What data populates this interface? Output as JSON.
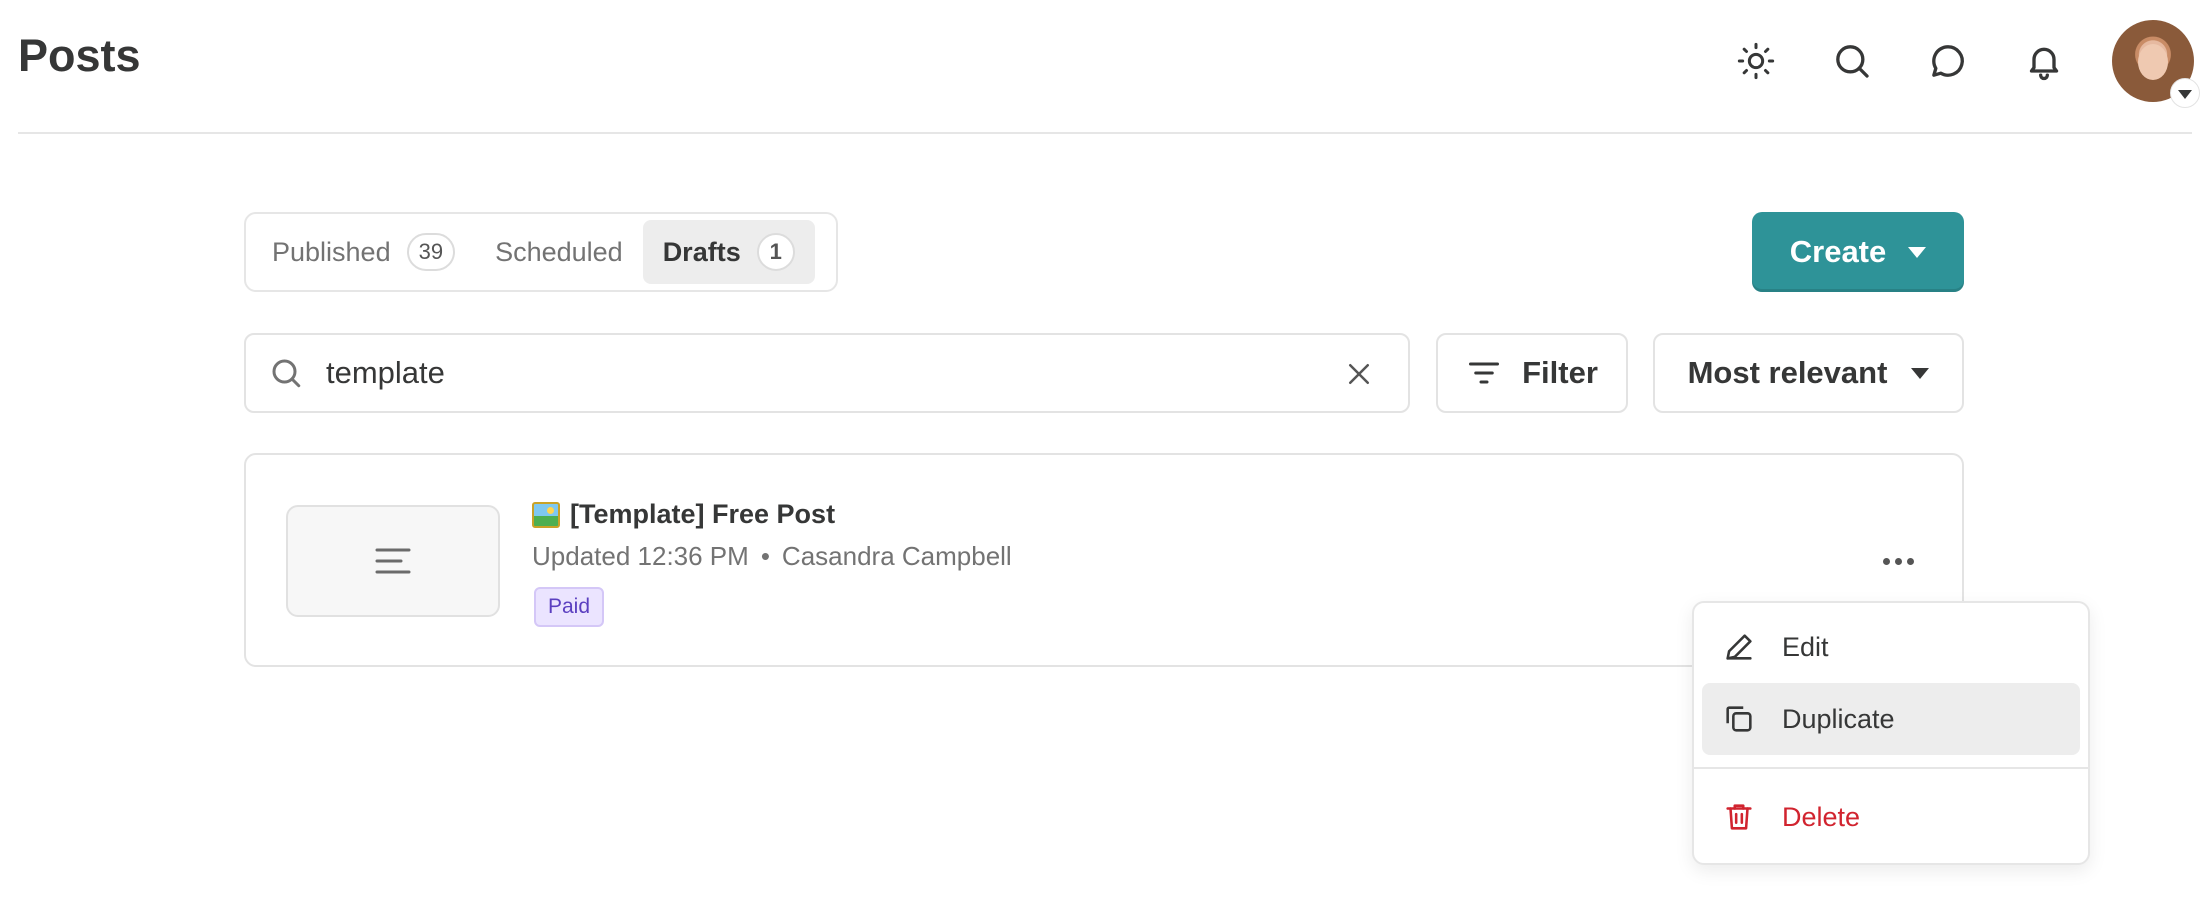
{
  "header": {
    "title": "Posts",
    "icons": [
      "theme-toggle-icon",
      "search-icon",
      "chat-icon",
      "bell-icon"
    ]
  },
  "tabs": [
    {
      "label": "Published",
      "count": "39",
      "active": false
    },
    {
      "label": "Scheduled",
      "count": null,
      "active": false
    },
    {
      "label": "Drafts",
      "count": "1",
      "active": true
    }
  ],
  "create_button": {
    "label": "Create"
  },
  "search": {
    "value": "template",
    "placeholder": "Search"
  },
  "filter_button": {
    "label": "Filter"
  },
  "sort_select": {
    "selected": "Most relevant"
  },
  "post": {
    "title": "[Template] Free Post",
    "updated": "Updated 12:36 PM",
    "separator": "•",
    "author": "Casandra Campbell",
    "badge": "Paid"
  },
  "menu": {
    "items": [
      {
        "label": "Edit",
        "icon": "pencil-icon"
      },
      {
        "label": "Duplicate",
        "icon": "duplicate-icon"
      },
      {
        "label": "Delete",
        "icon": "trash-icon"
      }
    ]
  },
  "colors": {
    "accent": "#2e9398",
    "danger": "#d1242f",
    "badge_bg": "#ebe4ff",
    "badge_text": "#5b3fc0"
  }
}
